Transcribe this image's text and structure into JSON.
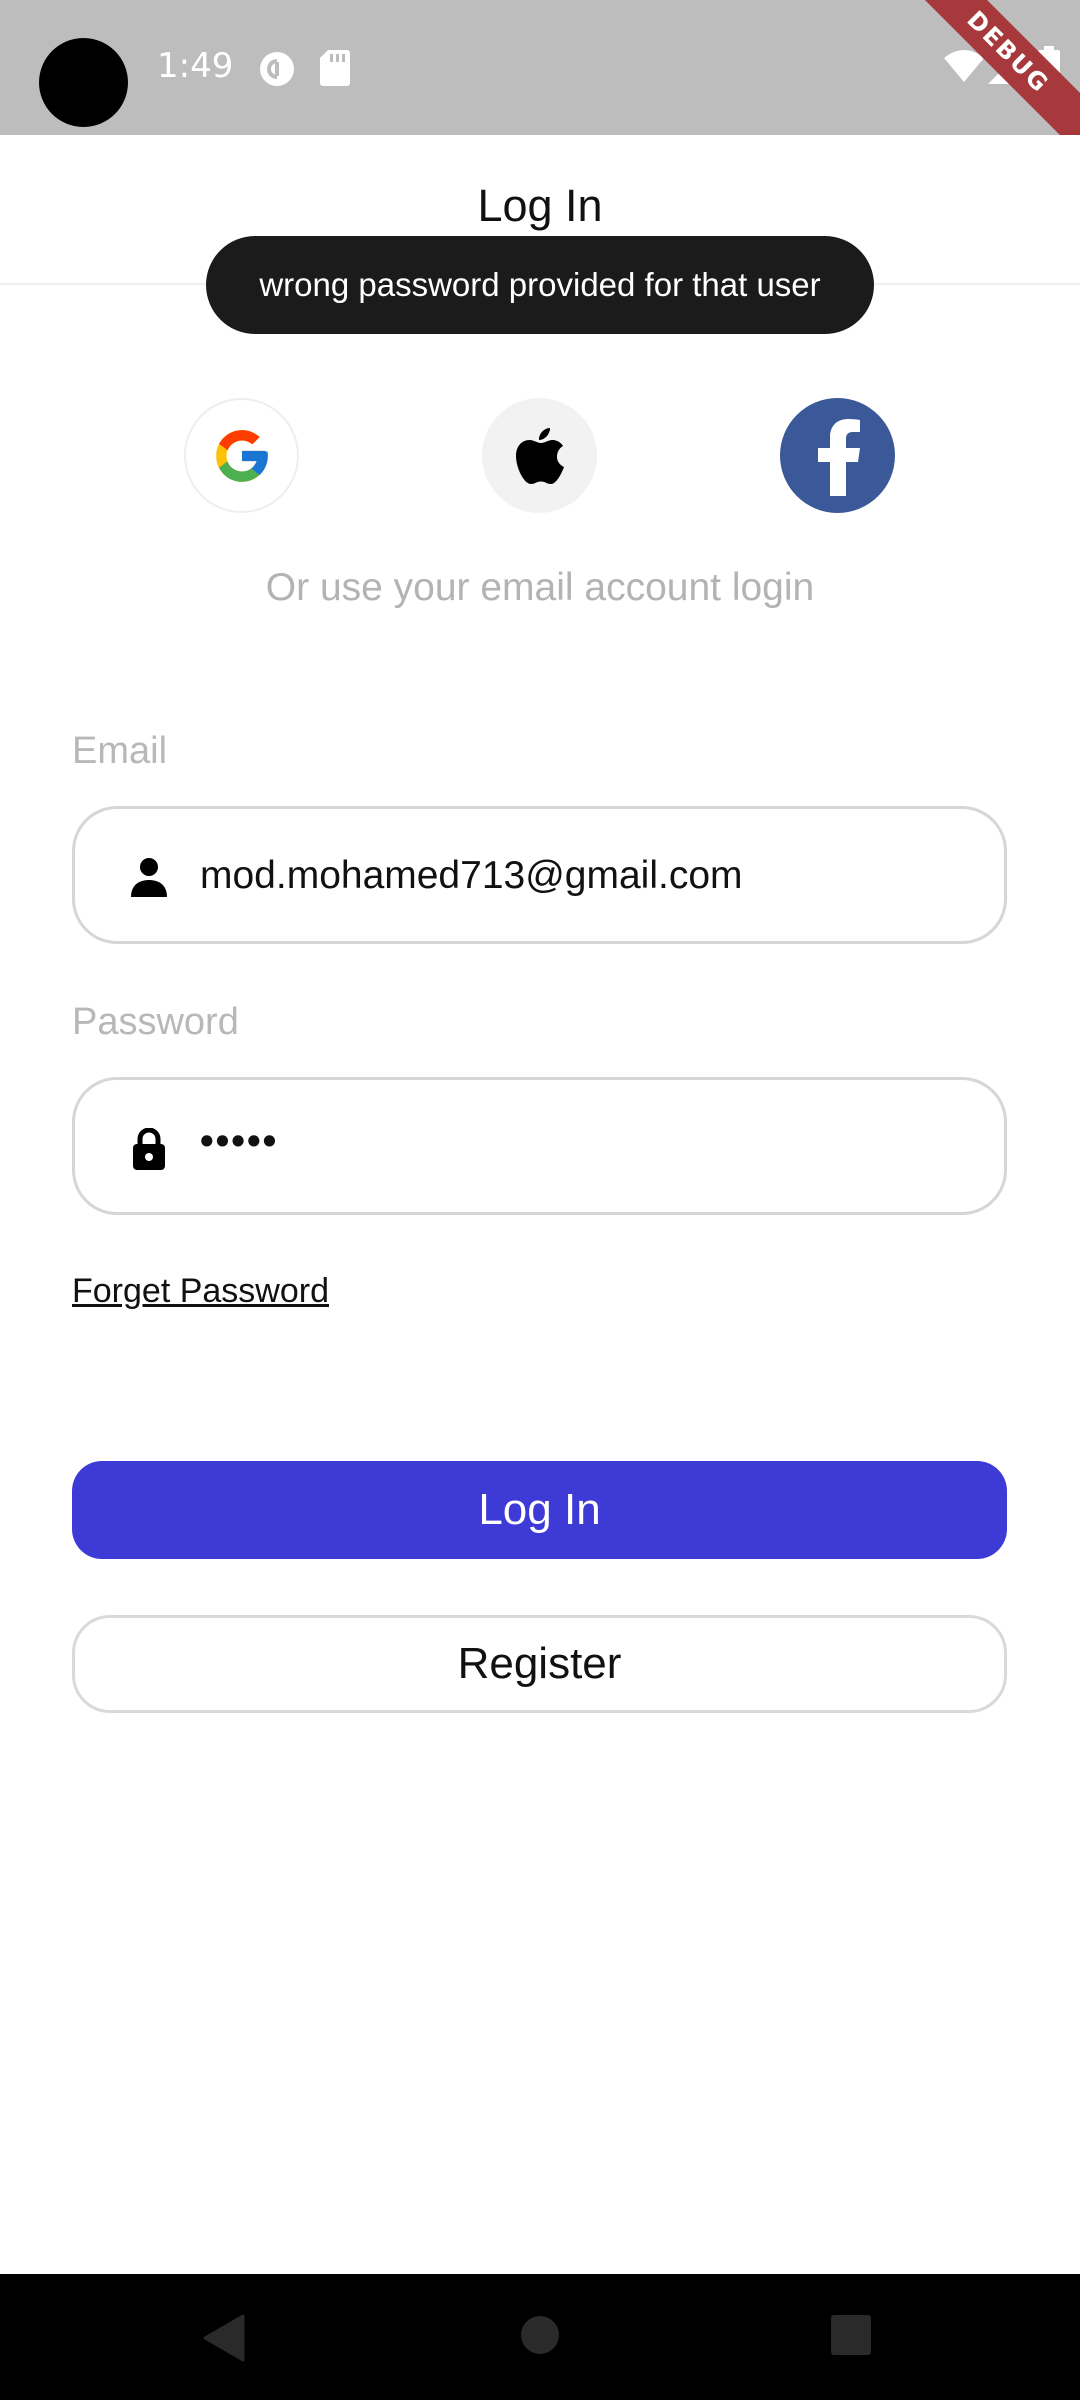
{
  "status_bar": {
    "time": "1:49",
    "icons": [
      "camera-cutout",
      "pocket-casts-icon",
      "sd-card-icon",
      "wifi-icon",
      "signal-icon",
      "battery-icon"
    ],
    "debug_banner": "DEBUG"
  },
  "app_bar": {
    "title": "Log In"
  },
  "toast": {
    "message": "wrong password provided for that user"
  },
  "social_login": {
    "buttons": [
      "google",
      "apple",
      "facebook"
    ],
    "alt_text": "Or use your email account login"
  },
  "form": {
    "email": {
      "label": "Email",
      "value": "mod.mohamed713@gmail.com",
      "icon": "person-icon"
    },
    "password": {
      "label": "Password",
      "value": "•••••",
      "icon": "lock-icon"
    },
    "forget_password": "Forget Password"
  },
  "actions": {
    "login_label": "Log In",
    "register_label": "Register"
  },
  "colors": {
    "primary": "#3d3ad5",
    "status_bar": "#bdbdbd",
    "facebook": "#3b5998",
    "toast": "#1b1b1b"
  },
  "nav_bar": {
    "buttons": [
      "back",
      "home",
      "recents"
    ]
  }
}
